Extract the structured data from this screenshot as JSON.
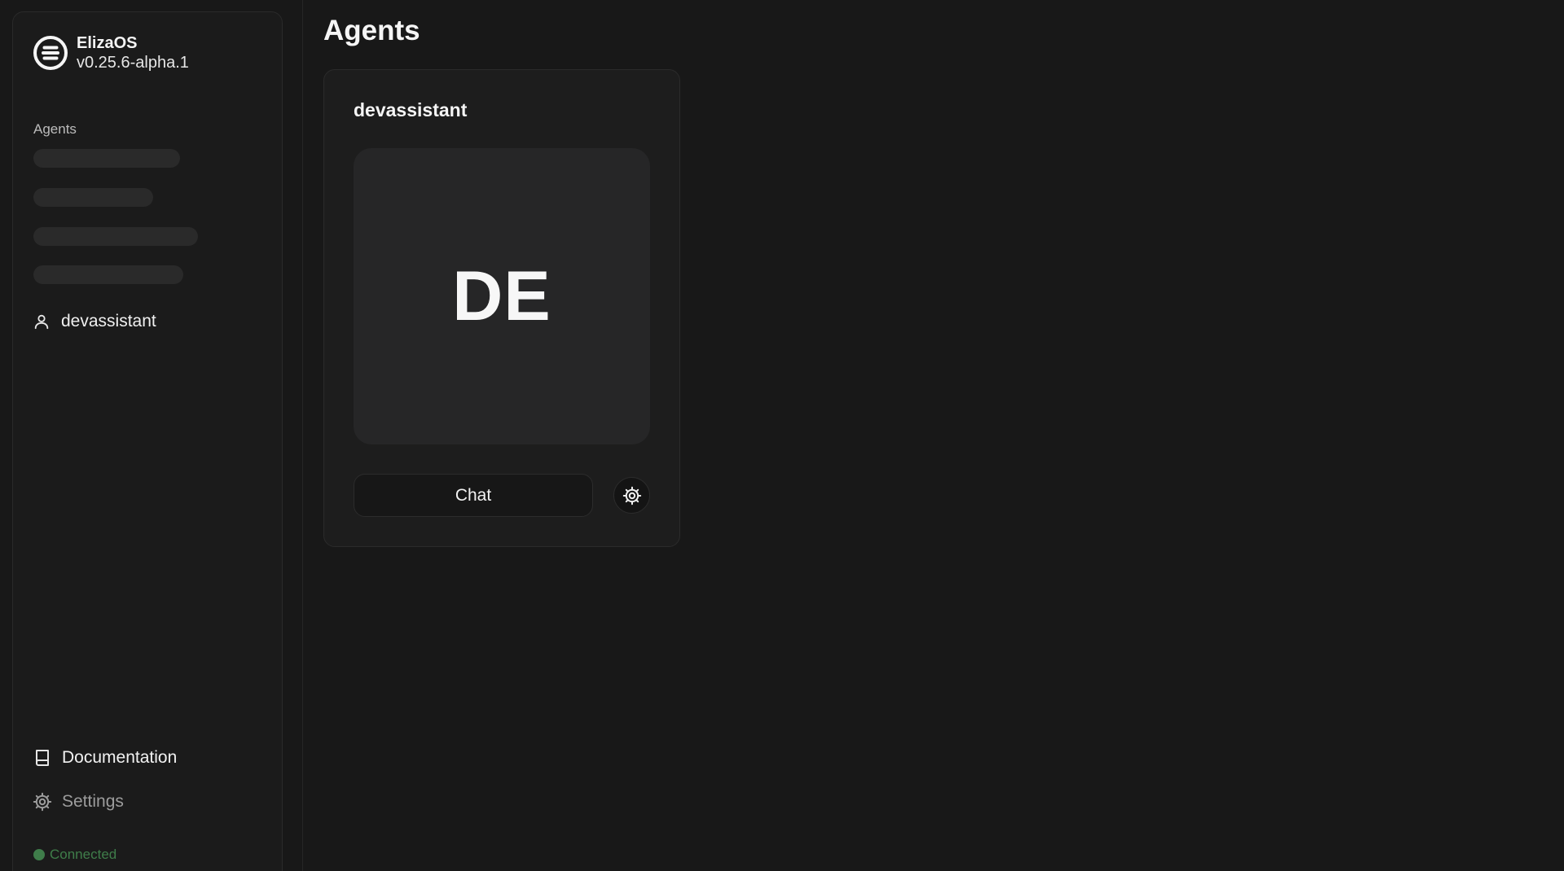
{
  "sidebar": {
    "brand": {
      "name": "ElizaOS",
      "version": "v0.25.6-alpha.1",
      "logo_icon": "eliza-logo-icon"
    },
    "agents_label": "Agents",
    "agents": [
      {
        "name": "devassistant",
        "icon": "user-icon"
      }
    ],
    "footer": {
      "documentation_label": "Documentation",
      "settings_label": "Settings",
      "status_text": "Connected",
      "status_color": "#3f7d4a"
    }
  },
  "main": {
    "title": "Agents",
    "cards": [
      {
        "name": "devassistant",
        "initials": "DE",
        "chat_label": "Chat",
        "settings_icon": "gear-icon"
      }
    ]
  },
  "colors": {
    "background": "#181818",
    "sidebar": "#1b1b1b",
    "card": "#1d1d1d",
    "avatar": "#262627",
    "skeleton": "#2a2a2a"
  }
}
